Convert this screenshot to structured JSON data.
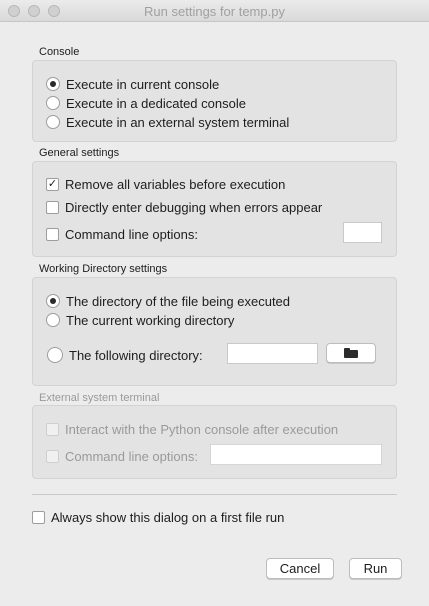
{
  "window": {
    "title": "Run settings for temp.py"
  },
  "console": {
    "label": "Console",
    "options": [
      {
        "label": "Execute in current console",
        "selected": true
      },
      {
        "label": "Execute in a dedicated console",
        "selected": false
      },
      {
        "label": "Execute in an external system terminal",
        "selected": false
      }
    ]
  },
  "general": {
    "label": "General settings",
    "remove_vars": {
      "label": "Remove all variables before execution",
      "checked": true
    },
    "debug": {
      "label": "Directly enter debugging when errors appear",
      "checked": false
    },
    "cmdline": {
      "label": "Command line options:",
      "checked": false,
      "value": ""
    }
  },
  "workdir": {
    "label": "Working Directory settings",
    "options": [
      {
        "label": "The directory of the file being executed",
        "selected": true
      },
      {
        "label": "The current working directory",
        "selected": false
      },
      {
        "label": "The following directory:",
        "selected": false
      }
    ],
    "dir_value": "",
    "browse_icon": "folder-open-icon"
  },
  "external": {
    "label": "External system terminal",
    "interact": {
      "label": "Interact with the Python console after execution",
      "checked": false
    },
    "cmdline": {
      "label": "Command line options:",
      "checked": false,
      "value": ""
    }
  },
  "always_show": {
    "label": "Always show this dialog on a first file run",
    "checked": false
  },
  "buttons": {
    "cancel": "Cancel",
    "run": "Run"
  }
}
